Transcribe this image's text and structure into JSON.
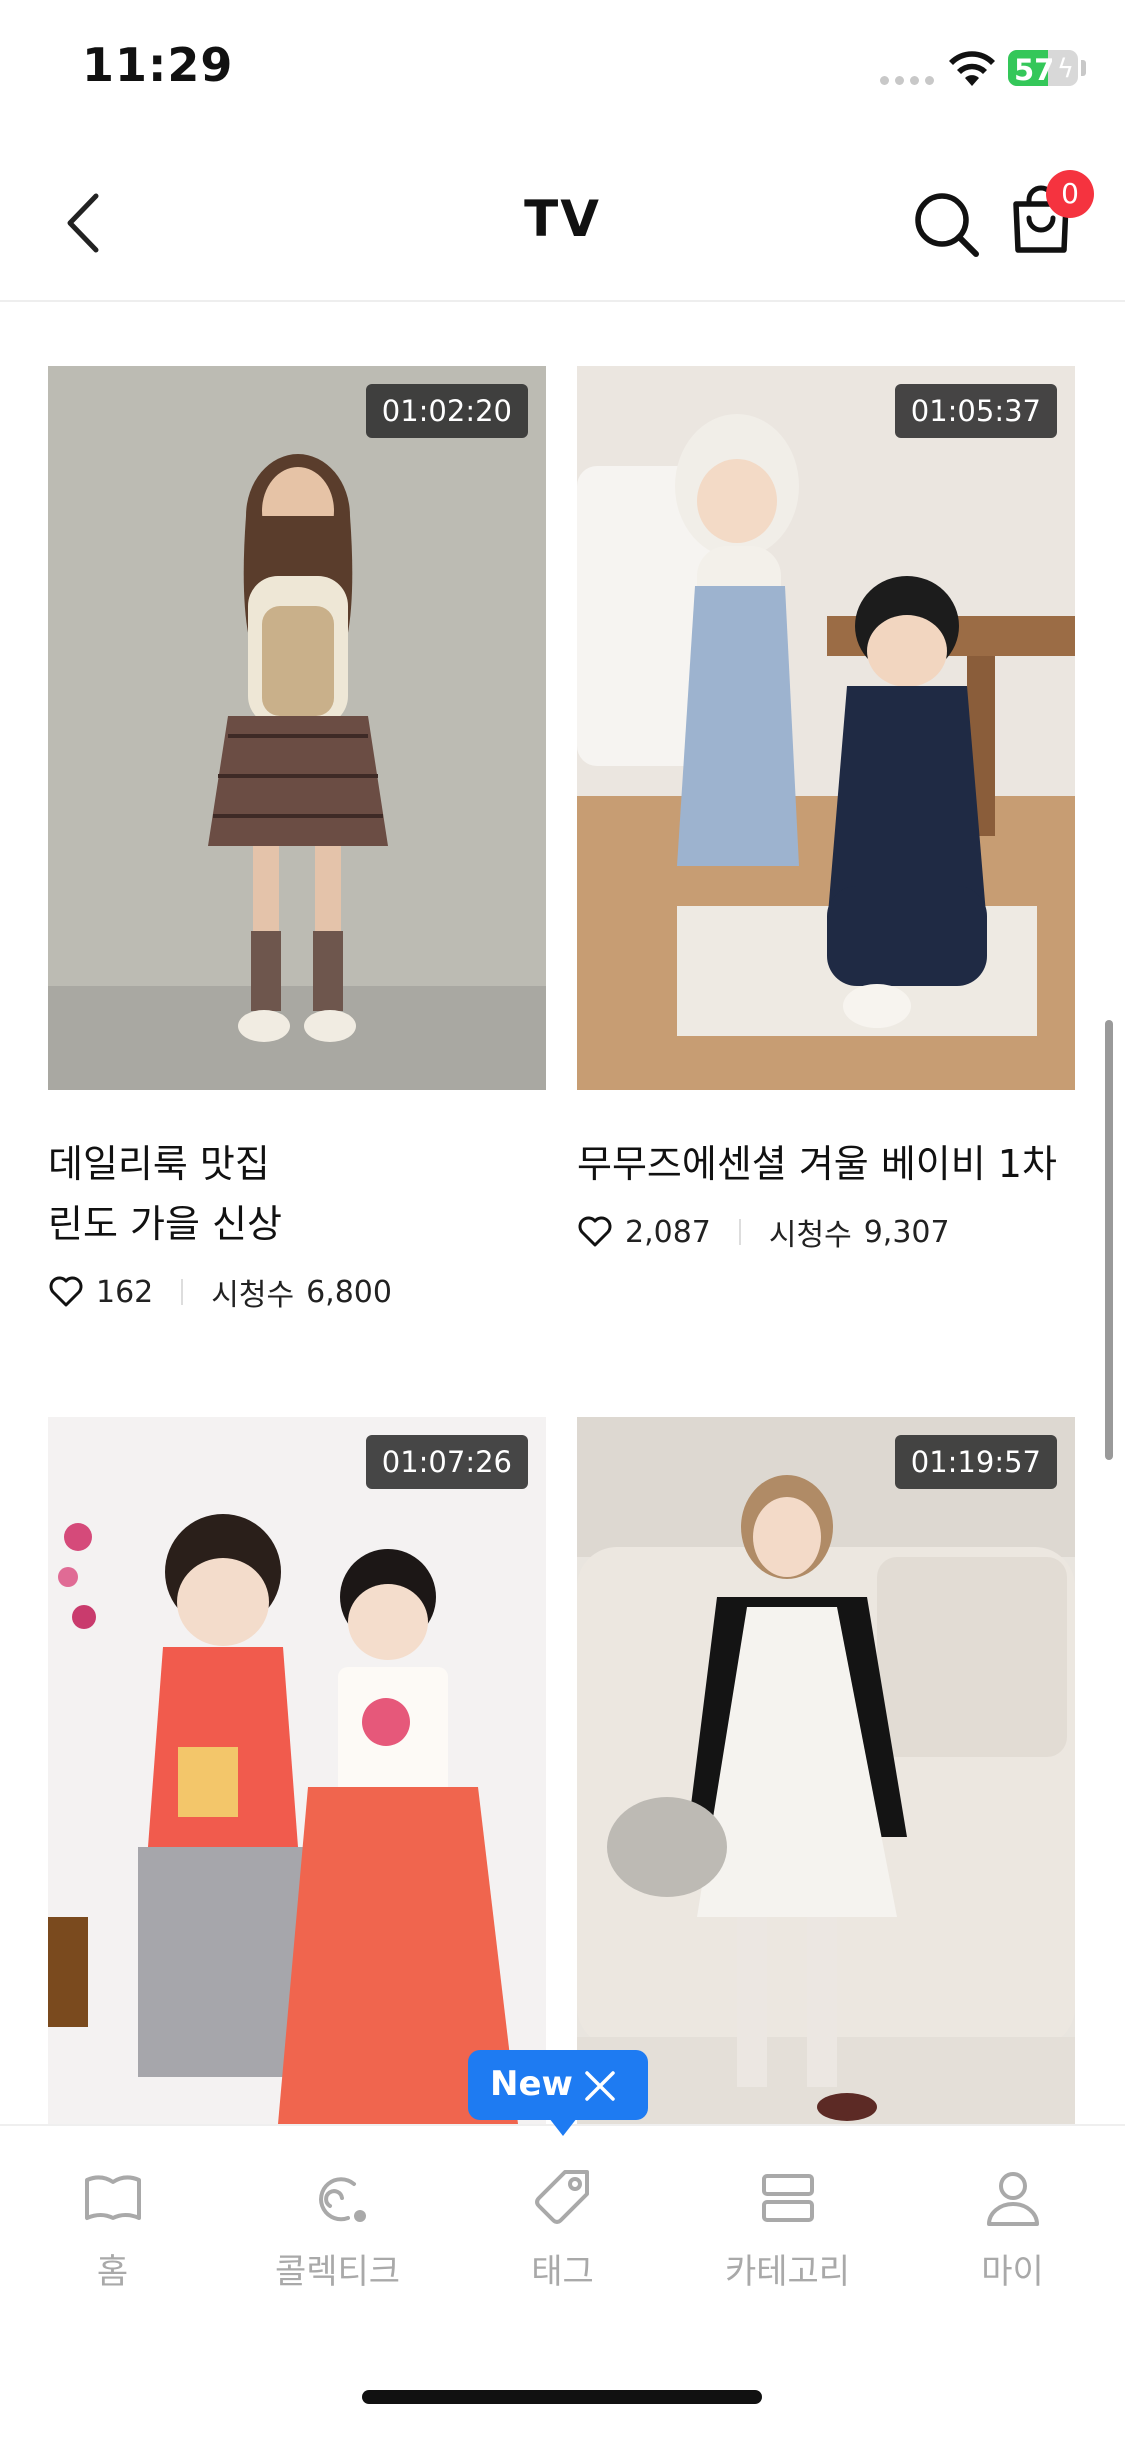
{
  "status_bar": {
    "time": "11:29",
    "battery": "57",
    "battery_level": 0.57
  },
  "header": {
    "title": "TV",
    "cart_count": "0"
  },
  "videos": [
    {
      "duration": "01:02:20",
      "title_lines": [
        "데일리룩 맛집",
        "린도 가을 신상"
      ],
      "likes": "162",
      "views_label": "시청수",
      "views": "6,800"
    },
    {
      "duration": "01:05:37",
      "title_lines": [
        "무무즈에센셜 겨울 베이비 1차"
      ],
      "likes": "2,087",
      "views_label": "시청수",
      "views": "9,307"
    },
    {
      "duration": "01:07:26"
    },
    {
      "duration": "01:19:57"
    }
  ],
  "tooltip": {
    "label": "New"
  },
  "tab_bar": {
    "items": [
      {
        "label": "홈",
        "icon": "book-icon"
      },
      {
        "label": "콜렉티크",
        "icon": "collection-icon"
      },
      {
        "label": "태그",
        "icon": "tag-icon"
      },
      {
        "label": "카테고리",
        "icon": "category-icon"
      },
      {
        "label": "마이",
        "icon": "person-icon"
      }
    ]
  },
  "colors": {
    "accent": "#1e7bf2",
    "badge": "#f5333f",
    "battery": "#34c759",
    "tab_inactive": "#a9a9a9"
  }
}
